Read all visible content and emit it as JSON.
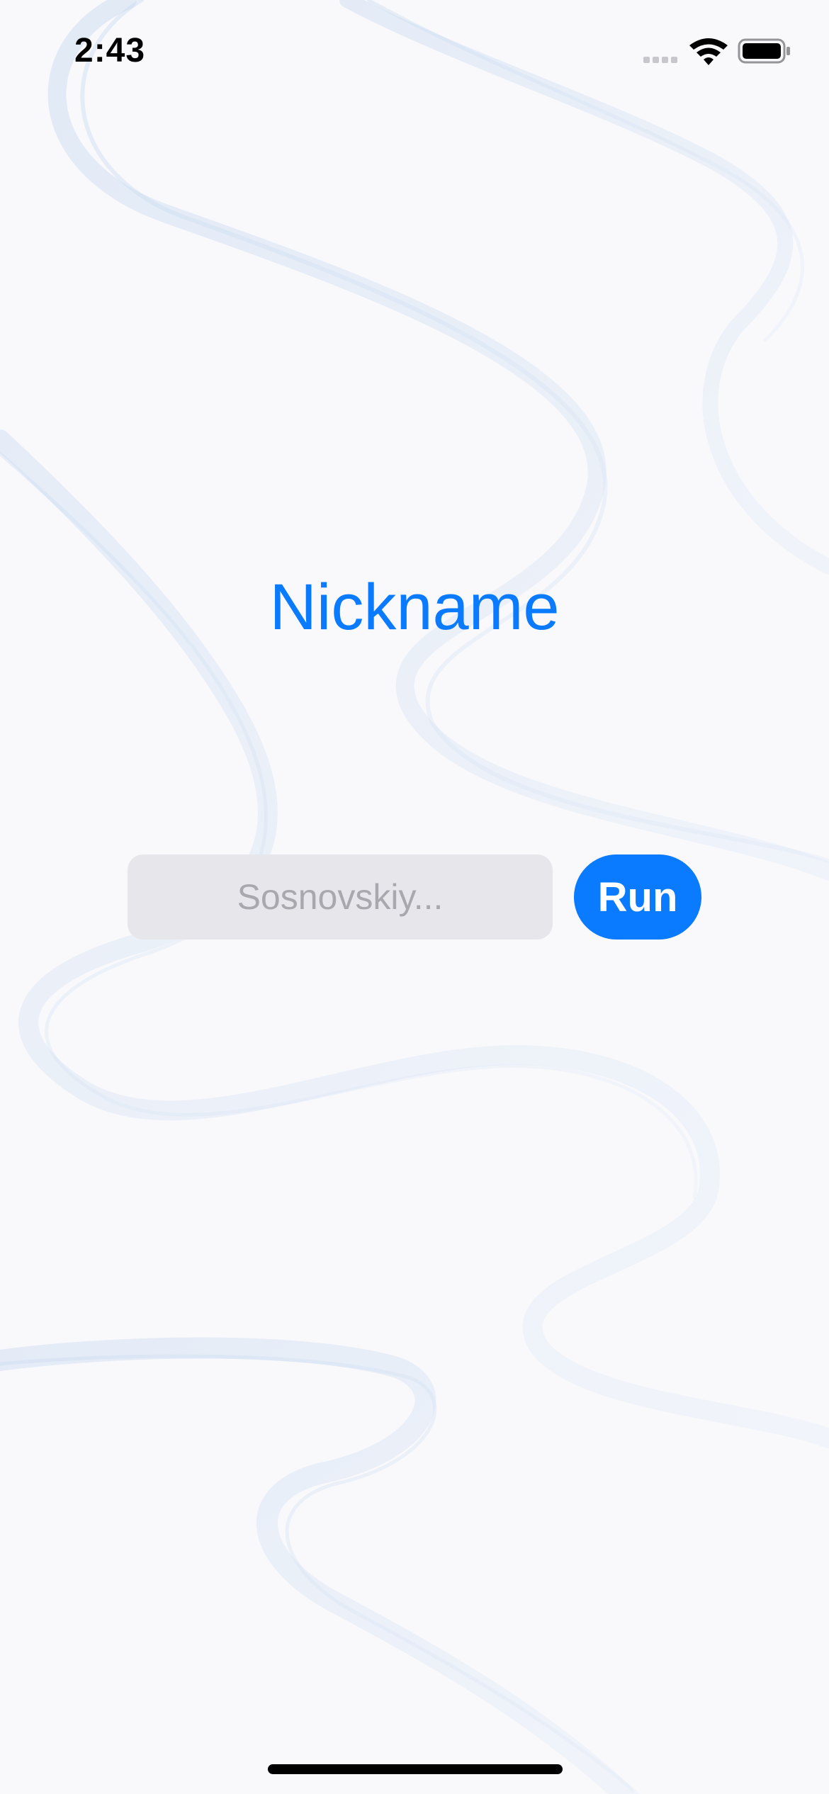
{
  "status_bar": {
    "time": "2:43",
    "icons": [
      "signal-icon",
      "wifi-icon",
      "battery-icon"
    ]
  },
  "main": {
    "title": "Nickname",
    "nickname_input": {
      "value": "",
      "placeholder": "Sosnovskiy..."
    },
    "run_button_label": "Run"
  },
  "colors": {
    "accent": "#0A7BFF",
    "background": "#F9F9FC",
    "input_background": "#E7E7EB",
    "placeholder": "#A8A8AE",
    "wave": "#C9DAF0"
  }
}
